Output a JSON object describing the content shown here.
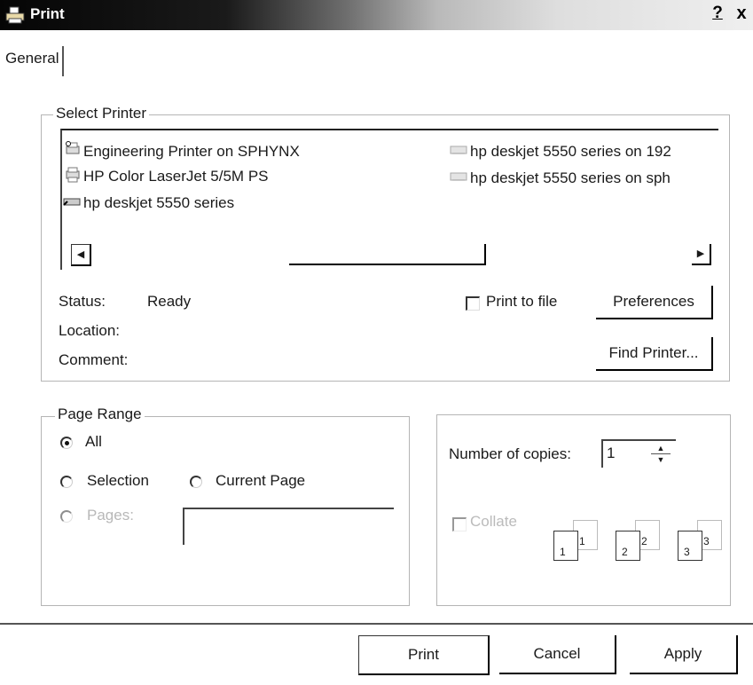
{
  "window": {
    "title": "Print",
    "help_label": "?",
    "close_label": "x"
  },
  "tabs": [
    {
      "label": "General"
    }
  ],
  "select_printer": {
    "legend": "Select Printer",
    "printers": [
      {
        "name": "Engineering Printer on SPHYNX",
        "icon": "network-printer-icon"
      },
      {
        "name": "HP Color LaserJet 5/5M PS",
        "icon": "printer-icon"
      },
      {
        "name": "hp deskjet 5550 series",
        "icon": "default-printer-icon"
      },
      {
        "name": "hp deskjet 5550 series on 192",
        "icon": "network-printer-icon"
      },
      {
        "name": "hp deskjet 5550 series on sph",
        "icon": "network-printer-icon"
      }
    ],
    "status_label": "Status:",
    "status_value": "Ready",
    "location_label": "Location:",
    "comment_label": "Comment:",
    "print_to_file_label": "Print to file",
    "preferences_label": "Preferences",
    "find_printer_label": "Find Printer..."
  },
  "page_range": {
    "legend": "Page Range",
    "all_label": "All",
    "selection_label": "Selection",
    "current_page_label": "Current Page",
    "pages_label": "Pages:",
    "selected": "All"
  },
  "copies": {
    "label": "Number of copies:",
    "value": "1",
    "collate_label": "Collate",
    "collate_pages": [
      "1",
      "1",
      "2",
      "2",
      "3",
      "3"
    ]
  },
  "buttons": {
    "print": "Print",
    "cancel": "Cancel",
    "apply": "Apply"
  }
}
